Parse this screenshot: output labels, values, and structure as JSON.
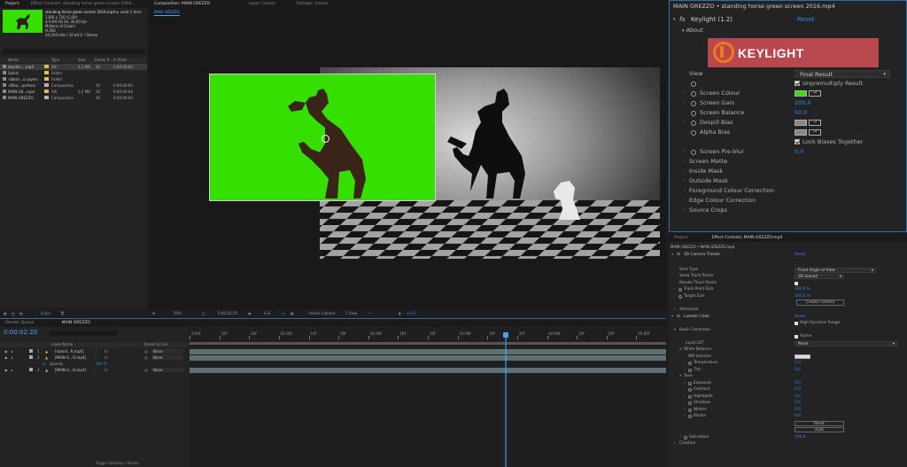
{
  "project_panel": {
    "tabs": [
      "Project",
      "Effect Controls: standing horse green screen 2016..."
    ],
    "selected_item": {
      "name": "standing horse green screen 2016.mp4 ▾",
      "used": ", used 1 time",
      "info": [
        "1280 x 720 (1,00)",
        "Δ 0:00:16:30, 30,00 fps",
        "Millions of Colors",
        "H.264",
        "44,100 kHz / 32 bit U / Stereo"
      ]
    },
    "columns": [
      "Name",
      "Type",
      "Size",
      "Frame R...",
      "In Point"
    ],
    "items": [
      {
        "name": "standin....mp4",
        "color": "#e6b84a",
        "type": "AVI",
        "size": "9,1 MB",
        "fps": "30",
        "in": "0:00:00:00"
      },
      {
        "name": "Solids",
        "color": "#d8c64a",
        "type": "Folder",
        "size": "",
        "fps": "",
        "in": ""
      },
      {
        "name": "<Bezn...a Layers",
        "color": "#d8c64a",
        "type": "Folder",
        "size": "",
        "fps": "",
        "in": ""
      },
      {
        "name": "<Blac...perlena",
        "color": "#c8a0c8",
        "type": "Composition",
        "size": "",
        "fps": "30",
        "in": "0:00:00:00"
      },
      {
        "name": "MAIN GR...mp4",
        "color": "#e6b84a",
        "type": "AVI",
        "size": "6,2 MB",
        "fps": "30",
        "in": "0:00:00:00"
      },
      {
        "name": "MAIN GREZZO",
        "color": "#c8a0c8",
        "type": "Composition",
        "size": "",
        "fps": "30",
        "in": "0:00:00:00"
      }
    ],
    "bpc": "8 bpc"
  },
  "comp_panel": {
    "tabs": [
      "Composition: MAIN GREZZO",
      "Layer: (none)",
      "Footage: (none)"
    ],
    "subtab": "MAIN GREZZO",
    "zoom": "50%",
    "timecode": "0:00:02:20",
    "resolution": "Full",
    "camera": "Active Camera",
    "view": "1 View",
    "exposure": "+0,0"
  },
  "effect_controls_top": {
    "title": "MAIN GREZZO • standing horse green screen 2016.mp4",
    "effect_name": "Keylight (1.2)",
    "reset": "Reset",
    "about": "About",
    "logo_text": "KEYLIGHT",
    "colors": {
      "screen": "#35e000",
      "logo_bg": "#b8484e",
      "logo_accent": "#f07a1e"
    },
    "rows": [
      {
        "label": "View",
        "value": "Final Result",
        "type": "dropdown"
      },
      {
        "label": "",
        "value": "Unpremultiply Result",
        "type": "checkbox"
      },
      {
        "label": "Screen Colour",
        "value": "",
        "type": "color"
      },
      {
        "label": "Screen Gain",
        "value": "100,0",
        "type": "number"
      },
      {
        "label": "Screen Balance",
        "value": "50,0",
        "type": "number"
      },
      {
        "label": "Despill Bias",
        "value": "",
        "type": "color-gray"
      },
      {
        "label": "Alpha Bias",
        "value": "",
        "type": "color-gray"
      },
      {
        "label": "",
        "value": "Lock Biases Together",
        "type": "checkbox"
      },
      {
        "label": "Screen Pre-blur",
        "value": "0,0",
        "type": "number"
      },
      {
        "label": "Screen Matte",
        "value": "",
        "type": "group"
      },
      {
        "label": "Inside Mask",
        "value": "",
        "type": "group"
      },
      {
        "label": "Outside Mask",
        "value": "",
        "type": "group"
      },
      {
        "label": "Foreground Colour Correction",
        "value": "",
        "type": "group"
      },
      {
        "label": "Edge Colour Correction",
        "value": "",
        "type": "group"
      },
      {
        "label": "Source Crops",
        "value": "",
        "type": "group"
      }
    ]
  },
  "effect_controls_bottom": {
    "tabs": [
      "Project",
      "Effect Controls: MAIN GREZZO.mp4"
    ],
    "title": "MAIN GREZZO • MAIN GREZZO.mp4",
    "tracker": {
      "name": "3D Camera Tracker",
      "reset": "Reset",
      "status": "3D Solved",
      "button": "Create Camera"
    },
    "rows": [
      {
        "label": "Shot Type",
        "value": "Fixed Angle of View"
      },
      {
        "label": "Show Track Points",
        "value": "3D Solved"
      },
      {
        "label": "Render Track Points",
        "value": ""
      },
      {
        "label": "Track Point Size",
        "value": "100,0 %"
      },
      {
        "label": "Target Size",
        "value": "100,0 %"
      }
    ],
    "advanced": "Advanced",
    "lumetri": {
      "name": "Lumetri Color",
      "reset": "Reset",
      "hdr": "High Dynamic Range"
    },
    "basic_correction": "Basic Correction",
    "active": "Active",
    "input_lut": {
      "label": "Input LUT",
      "value": "None"
    },
    "white_balance": "White Balance",
    "wb_rows": [
      {
        "label": "WB Selector",
        "value": ""
      },
      {
        "label": "Temperature",
        "value": "0,0"
      },
      {
        "label": "Tint",
        "value": "0,0"
      }
    ],
    "tone": "Tone",
    "tone_rows": [
      {
        "label": "Exposure",
        "value": "0,0"
      },
      {
        "label": "Contrast",
        "value": "0,0"
      },
      {
        "label": "Highlights",
        "value": "0,0"
      },
      {
        "label": "Shadows",
        "value": "0,0"
      },
      {
        "label": "Whites",
        "value": "0,0"
      },
      {
        "label": "Blacks",
        "value": "0,0"
      }
    ],
    "reset_btn": "Reset",
    "auto_btn": "Auto",
    "saturation": {
      "label": "Saturation",
      "value": "100,0"
    },
    "creative": "Creative"
  },
  "timeline": {
    "tabs": [
      "Render Queue",
      "MAIN GREZZO"
    ],
    "timecode": "0:00:02:20",
    "columns": [
      "Layer Name",
      "Parent & Link"
    ],
    "layers": [
      {
        "num": "1",
        "name": "[standi...ft.mp4]",
        "parent": "None"
      },
      {
        "num": "2",
        "name": "[MAIN G...O.mp4]",
        "parent": "None"
      },
      {
        "num": "3",
        "name": "[MAIN G...O.mp4]",
        "parent": "None"
      }
    ],
    "opacity": {
      "label": "Opacity",
      "value": "100 %"
    },
    "ruler": [
      "0:00f",
      "10f",
      "20f",
      "01:00f",
      "10f",
      "20f",
      "02:00f",
      "10f",
      "20f",
      "03:00f",
      "10f",
      "20f",
      "04:00f",
      "10f",
      "20f",
      "05:00f"
    ],
    "toggle": "Toggle Switches / Modes"
  }
}
